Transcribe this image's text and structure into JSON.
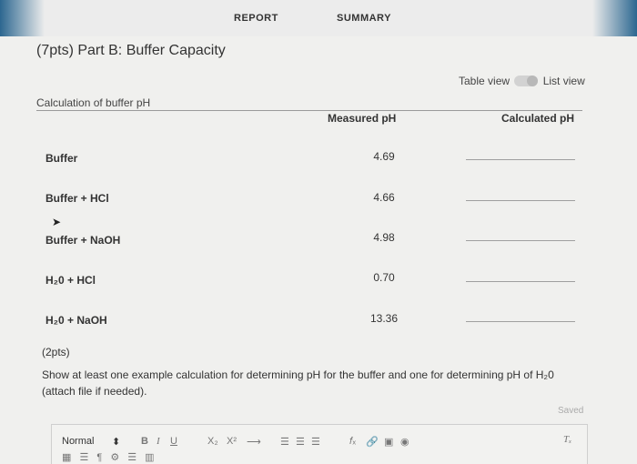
{
  "tabs": {
    "report": "REPORT",
    "summary": "SUMMARY"
  },
  "page_title": "(7pts) Part B: Buffer Capacity",
  "view_toggle": {
    "table": "Table view",
    "list": "List view"
  },
  "section_label": "Calculation of buffer pH",
  "columns": {
    "measured": "Measured pH",
    "calculated": "Calculated pH"
  },
  "rows": [
    {
      "label": "Buffer",
      "measured": "4.69"
    },
    {
      "label": "Buffer + HCl",
      "measured": "4.66"
    },
    {
      "label": "Buffer + NaOH",
      "measured": "4.98"
    },
    {
      "label": "H₂0 + HCl",
      "measured": "0.70"
    },
    {
      "label": "H₂0 + NaOH",
      "measured": "13.36"
    }
  ],
  "question": {
    "points": "(2pts)",
    "text": "Show at least one example calculation for determining pH for the buffer and one for determining pH of H₂0 (attach file if needed)."
  },
  "saved_status": "Saved",
  "editor_toolbar": {
    "style": "Normal",
    "style_arrow": "⬍",
    "bold": "B",
    "italic": "I",
    "underline": "U",
    "subscript": "X₂",
    "superscript": "X²",
    "arrow": "⟶",
    "list1": "☰",
    "list2": "☰",
    "list3": "☰",
    "formula": "𝑓ₓ",
    "link": "🔗",
    "image": "▣",
    "embed": "◉",
    "clear": "Tₓ",
    "row2": "▦ ☰ ¶ ⚙ ☰ ▥"
  },
  "colors": {
    "accent": "#2c6790",
    "background": "#f0f0ee"
  }
}
